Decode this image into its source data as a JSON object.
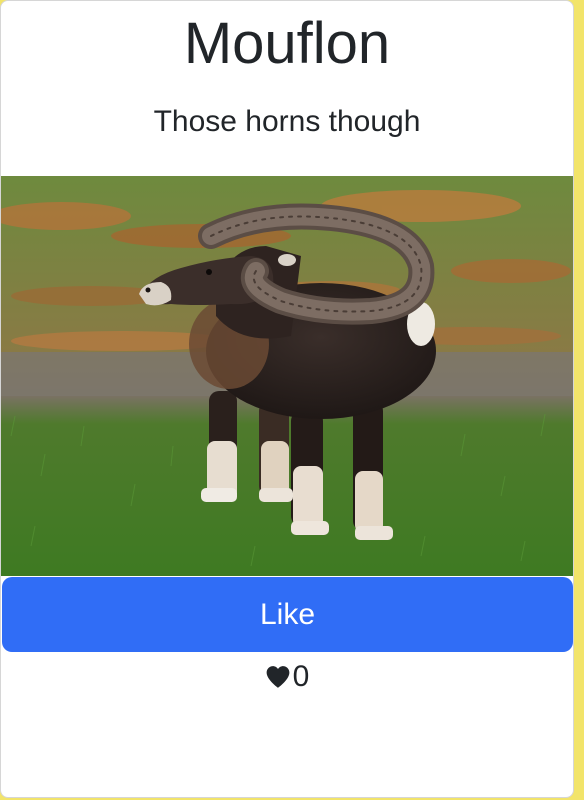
{
  "card": {
    "title": "Mouflon",
    "subtitle": "Those horns though",
    "image_alt": "Mouflon",
    "like_label": "Like",
    "like_count": "0",
    "heart_icon": "heart-icon"
  },
  "colors": {
    "button": "#306df6",
    "button_text": "#ffffff",
    "text": "#212529",
    "page_background": "#f2e46a"
  }
}
